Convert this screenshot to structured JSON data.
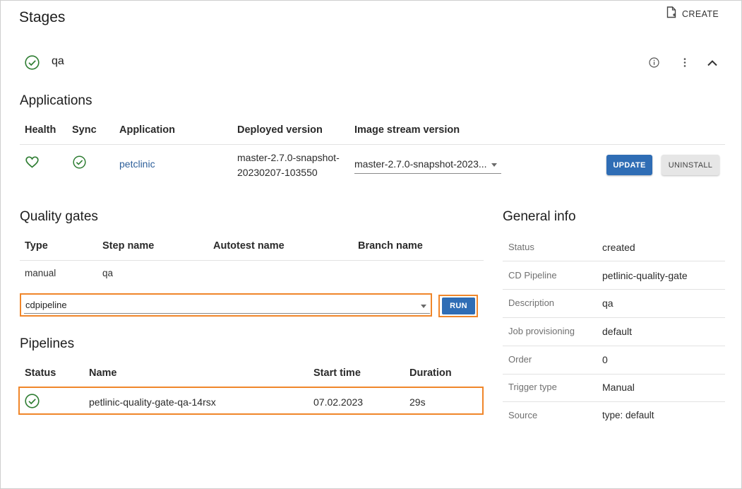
{
  "header": {
    "title": "Stages",
    "create_label": "CREATE"
  },
  "stage": {
    "name": "qa"
  },
  "applications": {
    "title": "Applications",
    "columns": [
      "Health",
      "Sync",
      "Application",
      "Deployed version",
      "Image stream version"
    ],
    "row": {
      "application": "petclinic",
      "deployed_version_line1": "master-2.7.0-snapshot-",
      "deployed_version_line2": "20230207-103550",
      "image_stream_version": "master-2.7.0-snapshot-2023...",
      "update_label": "UPDATE",
      "uninstall_label": "UNINSTALL"
    }
  },
  "quality_gates": {
    "title": "Quality gates",
    "columns": [
      "Type",
      "Step name",
      "Autotest name",
      "Branch name"
    ],
    "row": {
      "type": "manual",
      "step_name": "qa"
    },
    "select_value": "cdpipeline",
    "run_label": "RUN"
  },
  "pipelines": {
    "title": "Pipelines",
    "columns": [
      "Status",
      "Name",
      "Start time",
      "Duration"
    ],
    "row": {
      "name": "petlinic-quality-gate-qa-14rsx",
      "start_time": "07.02.2023",
      "duration": "29s"
    }
  },
  "general_info": {
    "title": "General info",
    "rows": [
      {
        "label": "Status",
        "value": "created"
      },
      {
        "label": "CD Pipeline",
        "value": "petlinic-quality-gate"
      },
      {
        "label": "Description",
        "value": "qa"
      },
      {
        "label": "Job provisioning",
        "value": "default"
      },
      {
        "label": "Order",
        "value": "0"
      },
      {
        "label": "Trigger type",
        "value": "Manual"
      },
      {
        "label": "Source",
        "value": "type: default"
      }
    ]
  },
  "colors": {
    "primary": "#2f6db5",
    "success": "#2e7d32",
    "highlight": "#f0862a",
    "link": "#2d5f9a"
  }
}
